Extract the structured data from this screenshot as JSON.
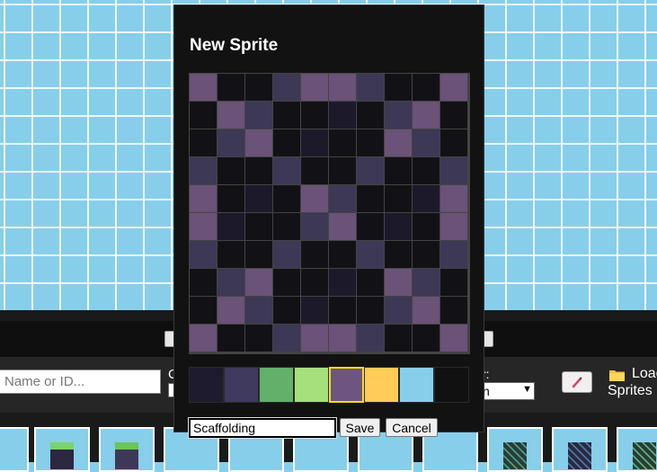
{
  "dialog": {
    "title": "New Sprite",
    "name_value": "Scaffolding",
    "save_label": "Save",
    "cancel_label": "Cancel",
    "grid": [
      [
        5,
        0,
        0,
        1,
        5,
        5,
        1,
        0,
        0,
        5
      ],
      [
        0,
        5,
        1,
        0,
        0,
        0,
        0,
        1,
        5,
        0
      ],
      [
        0,
        1,
        5,
        0,
        0,
        0,
        0,
        5,
        1,
        0
      ],
      [
        1,
        0,
        0,
        1,
        0,
        0,
        1,
        0,
        0,
        1
      ],
      [
        5,
        0,
        0,
        0,
        5,
        1,
        0,
        0,
        0,
        5
      ],
      [
        5,
        0,
        0,
        0,
        1,
        5,
        0,
        0,
        0,
        5
      ],
      [
        1,
        0,
        0,
        1,
        0,
        0,
        1,
        0,
        0,
        1
      ],
      [
        0,
        1,
        5,
        0,
        0,
        0,
        0,
        5,
        1,
        0
      ],
      [
        0,
        5,
        1,
        0,
        0,
        0,
        0,
        1,
        5,
        0
      ],
      [
        5,
        0,
        0,
        1,
        5,
        5,
        1,
        0,
        0,
        5
      ]
    ],
    "palette": [
      "#1e1b2e",
      "#3f3a5e",
      "#62b06a",
      "#a5e07c",
      "#6e5480",
      "#ffcc55",
      "#87ceeb",
      "#111111"
    ],
    "palette_selected": 4,
    "cell_colors": [
      "#151520",
      "#3d3856",
      "#0f0f0f",
      "#3d3856",
      "#0f0f0f",
      "#6a5278"
    ]
  },
  "toolbar": {
    "search_placeholder": "Name or ID...",
    "category_label": "C",
    "sort_label": "r:",
    "sort_value": "n",
    "load_label": "Load",
    "sprites_label": "Sprites",
    "paint_icon": "paintbrush-icon",
    "load_icon": "folder-icon"
  },
  "colors": {
    "sky": "#87ceeb",
    "dialog_bg": "#121212",
    "selected_border": "#ffe000"
  }
}
